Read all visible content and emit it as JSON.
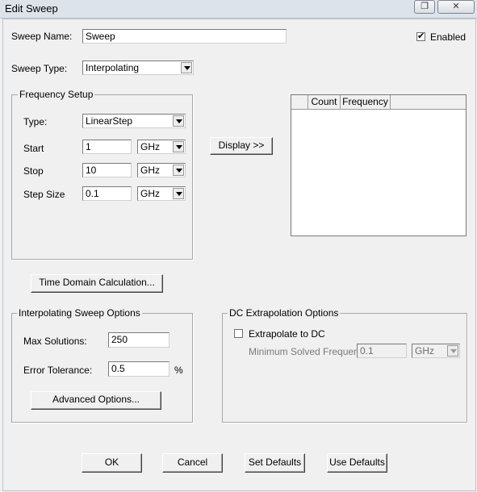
{
  "window": {
    "title": "Edit Sweep"
  },
  "sweep": {
    "name_label": "Sweep Name:",
    "name_value": "Sweep",
    "enabled_label": "Enabled",
    "enabled_checked": true,
    "type_label": "Sweep Type:",
    "type_value": "Interpolating"
  },
  "frequency_setup": {
    "group_label": "Frequency Setup",
    "type_label": "Type:",
    "type_value": "LinearStep",
    "start_label": "Start",
    "start_value": "1",
    "start_unit": "GHz",
    "stop_label": "Stop",
    "stop_value": "10",
    "stop_unit": "GHz",
    "step_label": "Step Size",
    "step_value": "0.1",
    "step_unit": "GHz"
  },
  "display_button": "Display >>",
  "table": {
    "columns": [
      "",
      "Count",
      "Frequency",
      ""
    ]
  },
  "time_domain_button": "Time Domain Calculation...",
  "interp_options": {
    "group_label": "Interpolating Sweep Options",
    "max_solutions_label": "Max Solutions:",
    "max_solutions_value": "250",
    "error_tolerance_label": "Error Tolerance:",
    "error_tolerance_value": "0.5",
    "error_tolerance_unit": "%",
    "advanced_button": "Advanced Options..."
  },
  "dc_options": {
    "group_label": "DC Extrapolation Options",
    "extrapolate_label": "Extrapolate to DC",
    "extrapolate_checked": false,
    "min_freq_label": "Minimum Solved Frequency",
    "min_freq_value": "0.1",
    "min_freq_unit": "GHz"
  },
  "buttons": {
    "ok": "OK",
    "cancel": "Cancel",
    "set_defaults": "Set Defaults",
    "use_defaults": "Use Defaults"
  },
  "colors": {
    "titlebar": "#dde3ea",
    "dialog_bg": "#f0f0f0",
    "field_bg": "#ffffff"
  }
}
